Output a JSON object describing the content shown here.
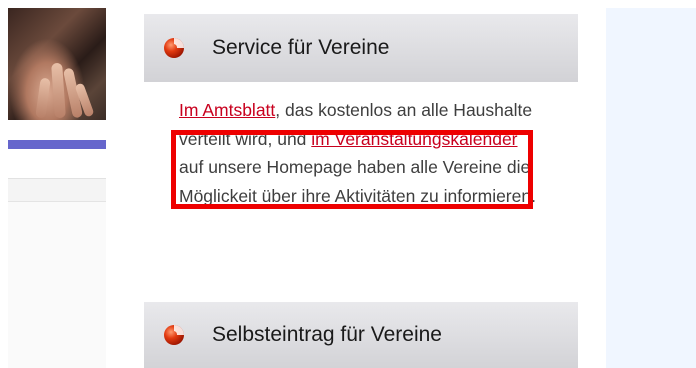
{
  "service_section": {
    "title": "Service für Vereine",
    "bullet_icon": "red-sphere-icon"
  },
  "service_text": {
    "link1": "Im Amtsblatt",
    "part1": ", das kostenlos an alle Haushalte verteilt wird, und ",
    "link2": "im Veranstaltungskalender",
    "part2": " auf unsere Homepage haben alle Vereine die Möglickeit über ihre Aktivitäten zu informieren."
  },
  "selbst_section": {
    "title": "Selbsteintrag für Vereine",
    "bullet_icon": "red-sphere-icon"
  },
  "colors": {
    "link": "#c8001e",
    "highlight": "#ee0000",
    "accent_bar": "#6666cc",
    "right_panel": "#f0f6ff"
  }
}
